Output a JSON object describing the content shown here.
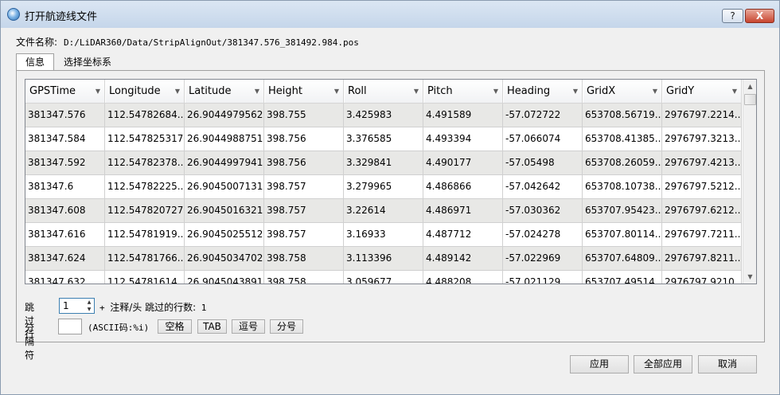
{
  "window": {
    "title": "打开航迹线文件",
    "help_label": "?",
    "close_label": "X"
  },
  "file": {
    "label": "文件名称:",
    "path": "D:/LiDAR360/Data/StripAlignOut/381347.576_381492.984.pos"
  },
  "tabs": [
    {
      "label": "信息",
      "active": true
    },
    {
      "label": "选择坐标系",
      "active": false
    }
  ],
  "table": {
    "columns": [
      "GPSTime",
      "Longitude",
      "Latitude",
      "Height",
      "Roll",
      "Pitch",
      "Heading",
      "GridX",
      "GridY"
    ],
    "rows": [
      [
        "381347.576",
        "112.54782684...",
        "26.9044979562",
        "398.755",
        "3.425983",
        "4.491589",
        "-57.072722",
        "653708.56719...",
        "2976797.2214..."
      ],
      [
        "381347.584",
        "112.547825317",
        "26.9044988751",
        "398.756",
        "3.376585",
        "4.493394",
        "-57.066074",
        "653708.41385...",
        "2976797.3213..."
      ],
      [
        "381347.592",
        "112.54782378...",
        "26.9044997941",
        "398.756",
        "3.329841",
        "4.490177",
        "-57.05498",
        "653708.26059...",
        "2976797.4213..."
      ],
      [
        "381347.6",
        "112.54782225...",
        "26.9045007131",
        "398.757",
        "3.279965",
        "4.486866",
        "-57.042642",
        "653708.10738...",
        "2976797.5212..."
      ],
      [
        "381347.608",
        "112.547820727",
        "26.9045016321",
        "398.757",
        "3.22614",
        "4.486971",
        "-57.030362",
        "653707.95423...",
        "2976797.6212..."
      ],
      [
        "381347.616",
        "112.54781919...",
        "26.9045025512",
        "398.757",
        "3.16933",
        "4.487712",
        "-57.024278",
        "653707.80114...",
        "2976797.7211..."
      ],
      [
        "381347.624",
        "112.54781766...",
        "26.9045034702",
        "398.758",
        "3.113396",
        "4.489142",
        "-57.022969",
        "653707.64809...",
        "2976797.8211..."
      ],
      [
        "381347.632",
        "112.54781614...",
        "26.9045043891",
        "398.758",
        "3.059677",
        "4.488208",
        "-57.021129",
        "653707.49514...",
        "2976797.9210..."
      ]
    ]
  },
  "skip": {
    "label": "跳过行",
    "value": "1",
    "note_prefix": "+ ",
    "note_cn": "注释/头 跳过的行数:",
    "note_count": " 1"
  },
  "separator": {
    "label": "分隔符",
    "value": "",
    "ascii_note": "(ASCII码:%i)",
    "buttons": [
      "空格",
      "TAB",
      "逗号",
      "分号"
    ]
  },
  "footer": {
    "apply": "应用",
    "apply_all": "全部应用",
    "cancel": "取消"
  }
}
